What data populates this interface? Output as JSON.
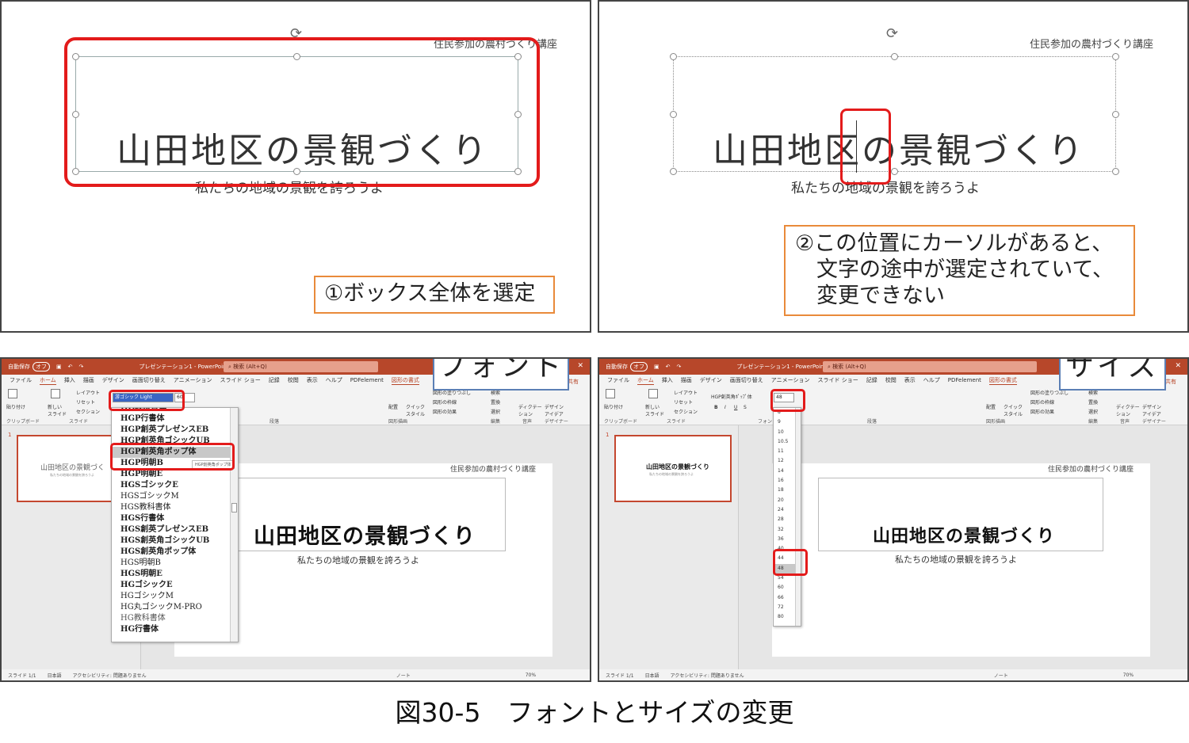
{
  "panel_tl": {
    "course": "住民参加の農村づくり講座",
    "title": "山田地区の景観づくり",
    "subtitle": "私たちの地域の景観を誇ろうよ",
    "callout": "①ボックス全体を選定"
  },
  "panel_tr": {
    "course": "住民参加の農村づくり講座",
    "title": "山田地区の景観づくり",
    "subtitle": "私たちの地域の景観を誇ろうよ",
    "callout": "②この位置にカーソルがあると、\n　文字の途中が選定されていて、\n　変更できない"
  },
  "ppt_common": {
    "autosave": "自動保存",
    "toggle": "オフ",
    "doc_title": "プレゼンテーション1 - PowerPoint",
    "search": "検索 (Alt+Q)",
    "tabs": [
      "ファイル",
      "ホーム",
      "挿入",
      "描画",
      "デザイン",
      "画面切り替え",
      "アニメーション",
      "スライド ショー",
      "記録",
      "校閲",
      "表示",
      "ヘルプ",
      "PDFelement",
      "図形の書式"
    ],
    "share": "共有",
    "groups": [
      "クリップボード",
      "スライド",
      "フォント",
      "段落",
      "図形描画",
      "編集",
      "音声",
      "デザイナー"
    ],
    "ribbon": {
      "paste": "貼り付け",
      "new_slide": "新しい\nスライド",
      "layout": "レイアウト",
      "reset": "リセット",
      "section": "セクション",
      "arrange": "配置",
      "quick_style": "クイック\nスタイル",
      "fill": "図形の塗りつぶし",
      "outline": "図形の枠線",
      "effect": "図形の効果",
      "find": "検索",
      "replace": "置換",
      "select": "選択",
      "dictate": "ディクテー\nション",
      "design_ideas": "デザイン\nアイデア"
    },
    "slide_no": "1",
    "status_slide": "スライド 1/1",
    "status_lang": "日本語",
    "status_access": "アクセシビリティ: 問題ありません",
    "status_note": "ノート",
    "zoom": "70%",
    "slide_course": "住民参加の農村づくり講座",
    "slide_title": "山田地区の景観づくり",
    "slide_subtitle": "私たちの地域の景観を誇ろうよ"
  },
  "panel_bl": {
    "label": "フォント",
    "font_combo": "游ゴシック Light",
    "size_combo": "60",
    "fonts": [
      "HG教科書体",
      "HGP行書体",
      "HGP創英プレゼンスEB",
      "HGP創英角ゴシックUB",
      "HGP創英角ポップ体",
      "HGP明朝B",
      "HGP明朝E",
      "HGSゴシックE",
      "HGSゴシックM",
      "HGS教科書体",
      "HGS行書体",
      "HGS創英プレゼンスEB",
      "HGS創英角ゴシックUB",
      "HGS創英角ポップ体",
      "HGS明朝B",
      "HGS明朝E",
      "HGゴシックE",
      "HGゴシックM",
      "HG丸ゴシックM-PRO",
      "HG教科書体",
      "HG行書体"
    ],
    "tooltip": "HGP創英角ポップ体",
    "thumb_title": "山田地区の景観づく",
    "thumb_sub": "私たちの地域の景観を誇ろうよ"
  },
  "panel_br": {
    "label": "サイズ",
    "font_combo": "HGP創英角ﾎﾟｯﾌﾟ体",
    "size_combo": "48",
    "sizes": [
      "8",
      "9",
      "10",
      "10.5",
      "11",
      "12",
      "14",
      "16",
      "18",
      "20",
      "24",
      "28",
      "32",
      "36",
      "40",
      "44",
      "48",
      "54",
      "60",
      "66",
      "72",
      "80"
    ],
    "thumb_title": "山田地区の景観づくり",
    "thumb_sub": "私たちの地域の景観を誇ろうよ"
  },
  "caption": "図30-5　フォントとサイズの変更",
  "colors": {
    "accent": "#b7472a",
    "highlight_red": "#e31b1b",
    "callout_border": "#e98a3a",
    "label_border": "#5b7fb5"
  }
}
